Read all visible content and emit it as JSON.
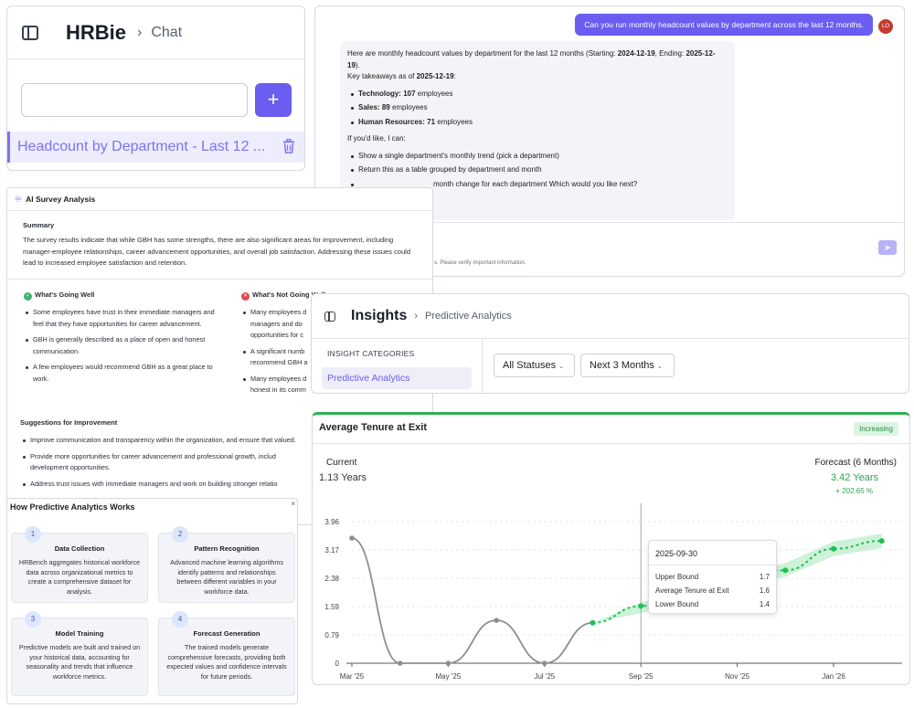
{
  "sidebar": {
    "app_title": "HRBie",
    "breadcrumb": "Chat",
    "new_chat_button": "+",
    "chat_items": [
      {
        "label": "Headcount by Department - Last 12 ..."
      }
    ]
  },
  "chat": {
    "user_message": "Can you run monthly headcount values by department across the last 12 months.",
    "avatar_initials": "LO",
    "reply": {
      "intro_prefix": "Here are monthly headcount values by department for the last 12 months (Starting: ",
      "start_date": "2024-12-19",
      "intro_mid": ", Ending: ",
      "end_date": "2025-12-19",
      "intro_suffix": ").",
      "takeaways_prefix": "Key takeaways as of ",
      "takeaways_date": "2025-12-19",
      "takeaways_suffix": ":",
      "stats": [
        {
          "dept": "Technology:",
          "count": "107",
          "unit": " employees"
        },
        {
          "dept": "Sales:",
          "count": "89",
          "unit": " employees"
        },
        {
          "dept": "Human Resources:",
          "count": "71",
          "unit": " employees"
        }
      ],
      "offer": "If you'd like, I can:",
      "options": [
        "Show a single department's monthly trend (pick a department)",
        "Return this as a table grouped by department and month",
        "month change for each department Which would you like next?"
      ]
    },
    "scroll_icon": "↓",
    "send_icon": "➤",
    "disclaimer": "s. Please verify important information."
  },
  "survey": {
    "title": "AI Survey Analysis",
    "summary_heading": "Summary",
    "summary_text": "The survey results indicate that while GBH has some strengths, there are also significant areas for improvement, including manager-employee relationships, career advancement opportunities, and overall job satisfaction. Addressing these issues could lead to increased employee satisfaction and retention.",
    "going_well_heading": "What's Going Well",
    "going_well": [
      "Some employees have trust in their immediate managers and feel that they have opportunities for career advancement.",
      "GBH is generally described as a place of open and honest communication.",
      "A few employees would recommend GBH as a great place to work."
    ],
    "not_going_well_heading": "What's Not Going Well",
    "not_going_well": [
      "Many employees d",
      "managers and do",
      "opportunities for c",
      "A significant numb",
      "recommend GBH a",
      "Many employees d",
      "honest in its comm"
    ],
    "suggestions_heading": "Suggestions for Improvement",
    "suggestions": [
      "Improve communication and transparency within the organization, and ensure that valued.",
      "Provide more opportunities for career advancement and professional growth, includ development opportunities.",
      "Address trust issues with immediate managers and work on building stronger relatio"
    ]
  },
  "how": {
    "title": "How Predictive Analytics Works",
    "close_icon": "×",
    "steps": [
      {
        "num": "1",
        "title": "Data Collection",
        "desc": "HRBench aggregates historical workforce data across organizational metrics to create a comprehensive dataset for analysis."
      },
      {
        "num": "2",
        "title": "Pattern Recognition",
        "desc": "Advanced machine learning algorithms identify patterns and relationships between different variables in your workforce data."
      },
      {
        "num": "3",
        "title": "Model Training",
        "desc": "Predictive models are built and trained on your historical data, accounting for seasonality and trends that influence workforce metrics."
      },
      {
        "num": "4",
        "title": "Forecast Generation",
        "desc": "The trained models generate comprehensive forecasts, providing both expected values and confidence intervals for future periods."
      }
    ]
  },
  "insights": {
    "title": "Insights",
    "breadcrumb": "Predictive Analytics",
    "category_heading": "INSIGHT CATEGORIES",
    "selected_category": "Predictive Analytics",
    "status_filter": "All Statuses",
    "period_filter": "Next 3 Months",
    "chevron": "⌄"
  },
  "tenure_card": {
    "title": "Average Tenure at Exit",
    "badge": "Increasing",
    "current_label": "Current",
    "current_value": "1.13 Years",
    "forecast_label": "Forecast (6 Months)",
    "forecast_value": "3.42 Years",
    "forecast_change": "+ 202.65 %",
    "tooltip": {
      "date": "2025-09-30",
      "rows": [
        {
          "label": "Upper Bound",
          "value": "1.7"
        },
        {
          "label": "Average Tenure at Exit",
          "value": "1.6"
        },
        {
          "label": "Lower Bound",
          "value": "1.4"
        }
      ]
    }
  },
  "chart_data": {
    "type": "line",
    "yticks": [
      "0",
      "0.79",
      "1.59",
      "2.38",
      "3.17",
      "3.96"
    ],
    "ylim": [
      0,
      3.96
    ],
    "xticks": [
      "Mar '25",
      "May '25",
      "Jul '25",
      "Sep '25",
      "Nov '25",
      "Jan '26"
    ],
    "series": [
      {
        "kind": "actual",
        "x": [
          "2025-03",
          "2025-04",
          "2025-05",
          "2025-06",
          "2025-07",
          "2025-08"
        ],
        "y": [
          3.5,
          0.0,
          0.0,
          1.2,
          0.0,
          1.13
        ]
      },
      {
        "kind": "forecast",
        "x": [
          "2025-08",
          "2025-09",
          "2025-10",
          "2025-11",
          "2025-12",
          "2026-01",
          "2026-02"
        ],
        "y": [
          1.13,
          1.6,
          1.9,
          2.3,
          2.6,
          3.2,
          3.42
        ],
        "upper": [
          1.13,
          1.7,
          2.05,
          2.48,
          2.8,
          3.4,
          3.62
        ],
        "lower": [
          1.13,
          1.4,
          1.72,
          2.12,
          2.42,
          3.0,
          3.22
        ]
      }
    ],
    "highlight_x": "2025-09",
    "colors": {
      "actual": "#8e8e93",
      "forecast": "#22c04f",
      "band": "#c6efd2"
    }
  }
}
